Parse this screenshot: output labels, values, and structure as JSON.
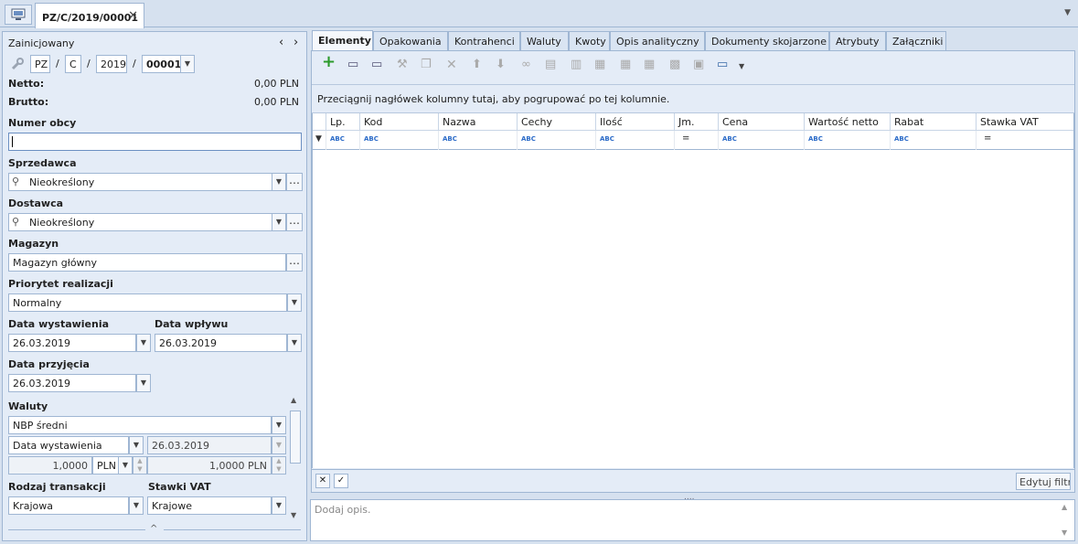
{
  "document_tab": {
    "title": "PZ/C/2019/00001",
    "close": "✕"
  },
  "left": {
    "status": "Zainicjowany",
    "doc_number": {
      "type": "PZ",
      "series": "C",
      "year": "2019",
      "number": "00001"
    },
    "netto_label": "Netto:",
    "netto_value": "0,00 PLN",
    "brutto_label": "Brutto:",
    "brutto_value": "0,00 PLN",
    "numer_obcy_label": "Numer obcy",
    "numer_obcy_value": "",
    "sprzedawca_label": "Sprzedawca",
    "sprzedawca_value": "Nieokreślony",
    "dostawca_label": "Dostawca",
    "dostawca_value": "Nieokreślony",
    "magazyn_label": "Magazyn",
    "magazyn_value": "Magazyn główny",
    "priorytet_label": "Priorytet realizacji",
    "priorytet_value": "Normalny",
    "data_wystawienia_label": "Data wystawienia",
    "data_wystawienia_value": "26.03.2019",
    "data_wplywu_label": "Data wpływu",
    "data_wplywu_value": "26.03.2019",
    "data_przyjecia_label": "Data przyjęcia",
    "data_przyjecia_value": "26.03.2019",
    "waluty_label": "Waluty",
    "kurs_value": "NBP średni",
    "kurs_date_type": "Data wystawienia",
    "kurs_date": "26.03.2019",
    "rate_value": "1,0000",
    "rate_currency": "PLN",
    "rate_result": "1,0000 PLN",
    "rodzaj_transakcji_label": "Rodzaj transakcji",
    "rodzaj_transakcji_value": "Krajowa",
    "stawki_vat_label": "Stawki VAT",
    "stawki_vat_value": "Krajowe"
  },
  "tabs": [
    "Elementy",
    "Opakowania",
    "Kontrahenci",
    "Waluty",
    "Kwoty",
    "Opis analityczny",
    "Dokumenty skojarzone",
    "Atrybuty",
    "Załączniki"
  ],
  "group_hint": "Przeciągnij nagłówek kolumny tutaj, aby pogrupować po tej kolumnie.",
  "columns": [
    "Lp.",
    "Kod",
    "Nazwa",
    "Cechy",
    "Ilość",
    "Jm.",
    "Cena",
    "Wartość netto",
    "Rabat",
    "Stawka VAT"
  ],
  "edit_filter_label": "Edytuj filtr",
  "description_placeholder": "Dodaj opis."
}
